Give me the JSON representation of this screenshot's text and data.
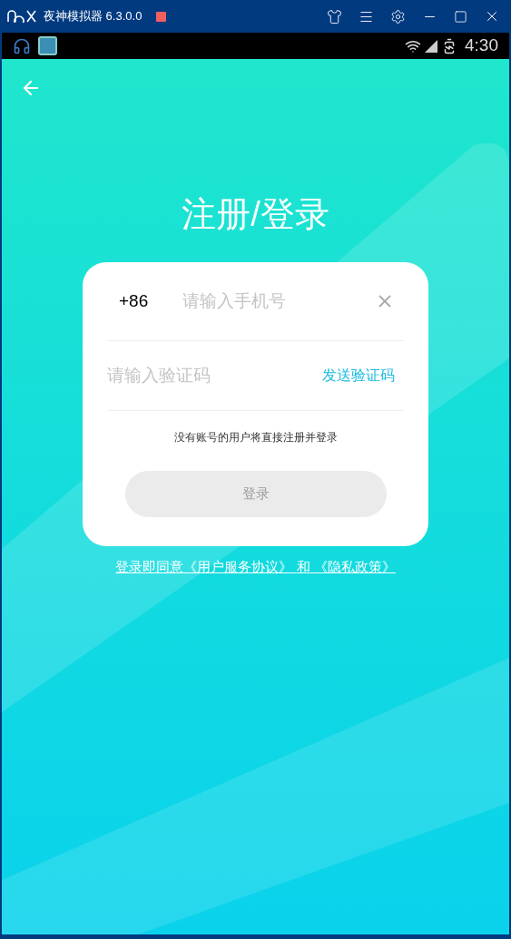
{
  "window": {
    "title": "夜神模拟器 6.3.0.0"
  },
  "status_bar": {
    "time": "4:30"
  },
  "page": {
    "title": "注册/登录"
  },
  "form": {
    "country_code": "+86",
    "phone_placeholder": "请输入手机号",
    "code_placeholder": "请输入验证码",
    "send_code": "发送验证码",
    "hint": "没有账号的用户将直接注册并登录",
    "login_button": {
      "label": "登录",
      "disabled": true
    }
  },
  "terms": {
    "prefix": "登录即同意",
    "link_1": "《用户服务协议》",
    "middle": "和",
    "link_2": "《隐私政策》"
  }
}
